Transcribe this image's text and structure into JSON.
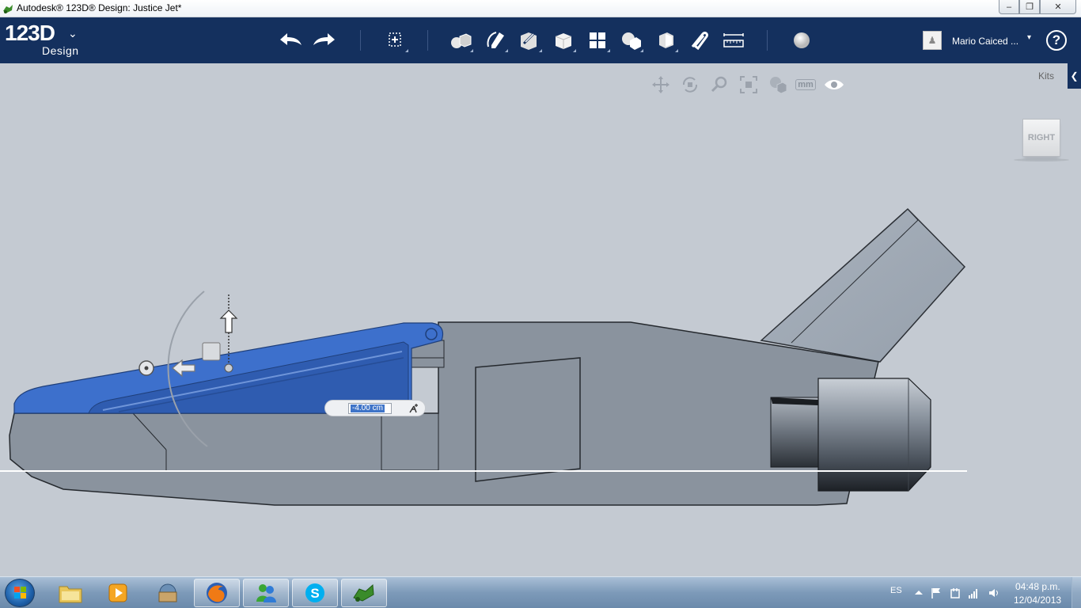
{
  "window": {
    "title": "Autodesk® 123D® Design: Justice Jet*",
    "minimize": "–",
    "maximize": "❐",
    "close": "✕"
  },
  "toolbar": {
    "logo_number": "123D",
    "logo_sub": "Design",
    "logo_chevron": "⌄",
    "icons": [
      "undo-icon",
      "redo-icon",
      "transform-icon",
      "primitives-icon",
      "sketch-icon",
      "construct-icon",
      "modify-icon",
      "pattern-icon",
      "grouping-icon",
      "combine-icon",
      "snap-icon",
      "measure-icon",
      "material-icon"
    ],
    "user_name": "Mario Caiced ...",
    "user_caret": "▾",
    "help": "?"
  },
  "viewport": {
    "nav_icons": [
      "pan-icon",
      "orbit-icon",
      "zoom-icon",
      "fit-icon",
      "view-mode-icon",
      "units-icon",
      "visibility-icon"
    ],
    "units_label": "mm",
    "kits_label": "Kits",
    "kits_arrow": "❮",
    "viewcube_label": "RIGHT",
    "dimension_value": "-4.00 cm",
    "selection_color": "#3d70cc",
    "body_color": "#8a939e"
  },
  "taskbar": {
    "apps": [
      "explorer-icon",
      "media-player-icon",
      "app-icon",
      "firefox-icon",
      "messenger-icon",
      "skype-icon",
      "123d-design-icon"
    ],
    "language": "ES",
    "time": "04:48 p.m.",
    "date": "12/04/2013"
  }
}
